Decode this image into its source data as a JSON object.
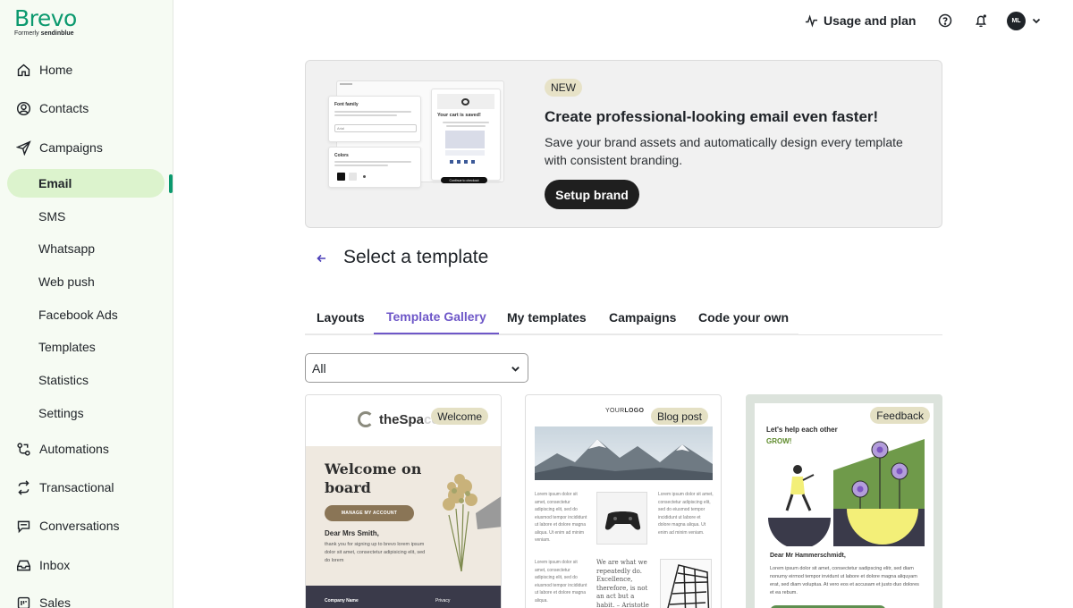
{
  "brand": {
    "name": "Brevo",
    "formerly_prefix": "Formerly",
    "formerly_name": "sendinblue",
    "accent": "#0b996e"
  },
  "sidebar": {
    "items": [
      {
        "label": "Home",
        "icon": "home-icon"
      },
      {
        "label": "Contacts",
        "icon": "contacts-icon"
      },
      {
        "label": "Campaigns",
        "icon": "send-icon"
      }
    ],
    "campaign_subitems": [
      {
        "label": "Email",
        "active": true
      },
      {
        "label": "SMS"
      },
      {
        "label": "Whatsapp"
      },
      {
        "label": "Web push"
      },
      {
        "label": "Facebook Ads"
      },
      {
        "label": "Templates"
      },
      {
        "label": "Statistics"
      },
      {
        "label": "Settings"
      }
    ],
    "items_after": [
      {
        "label": "Automations",
        "icon": "automations-icon"
      },
      {
        "label": "Transactional",
        "icon": "transactional-icon"
      },
      {
        "label": "Conversations",
        "icon": "chat-icon"
      },
      {
        "label": "Inbox",
        "icon": "inbox-icon"
      },
      {
        "label": "Sales",
        "icon": "sales-icon"
      }
    ]
  },
  "topbar": {
    "usage_label": "Usage and plan",
    "avatar_initials": "ML"
  },
  "banner": {
    "badge": "NEW",
    "title": "Create professional-looking email even faster!",
    "description": "Save your brand assets and automatically design every template with consistent branding.",
    "button": "Setup brand",
    "mock": {
      "font_title": "Font family",
      "colors_title": "Colors",
      "cart_title": "Your cart is saved!",
      "select_value": "Arial",
      "checkout": "Continue to checkout"
    }
  },
  "page": {
    "title": "Select a template"
  },
  "tabs": [
    {
      "label": "Layouts"
    },
    {
      "label": "Template Gallery",
      "active": true
    },
    {
      "label": "My templates"
    },
    {
      "label": "Campaigns"
    },
    {
      "label": "Code your own"
    }
  ],
  "filter": {
    "value": "All"
  },
  "cards": [
    {
      "tag": "Welcome",
      "logo_main": "theSpa",
      "logo_fade": "ce",
      "title_line1": "Welcome on",
      "title_line2": "board",
      "button": "MANAGE MY ACCOUNT",
      "greeting": "Dear Mrs Smith,",
      "body": "thank you for signing up to brevo lorem ipsum dolor sit amet, consectetur adipisicing elit, sed do lorem",
      "footer_left": "Company Name",
      "footer_right": "Privacy"
    },
    {
      "tag": "Blog post",
      "logo_your": "YOUR",
      "logo_logo": "LOGO",
      "lorem1": "Lorem ipsum dolor sit amet, consectetur adipiscing elit, sed do eiusmod tempor incididunt ut labore et dolore magna aliqua. Ut enim ad minim veniam.",
      "lorem2": "Lorem ipsum dolor sit amet, consectetur adipiscing elit, sed do eiusmod tempor incididunt ut labore et dolore magna aliqua. Ut enim ad minim veniam.",
      "lorem3": "Lorem ipsum dolor sit amet, consectetur adipiscing elit, sed do eiusmod tempor incididunt ut labore et dolore magna aliqua.",
      "quote": "We are what we repeatedly do. Excellence, therefore, is not an act but a habit. – Aristotle"
    },
    {
      "tag": "Feedback",
      "head_line1": "Let's help each other",
      "head_grow": "GROW!",
      "greeting": "Dear Mr Hammerschmidt,",
      "body": "Lorem ipsum dolor sit amet, consectetur sadipscing elitr, sed diam nonumy eirmod tempor invidunt ut labore et dolore magna aliquyam erat, sed diam voluptua. At vero eos et accusam et justo duo dolores et ea rebum."
    }
  ]
}
